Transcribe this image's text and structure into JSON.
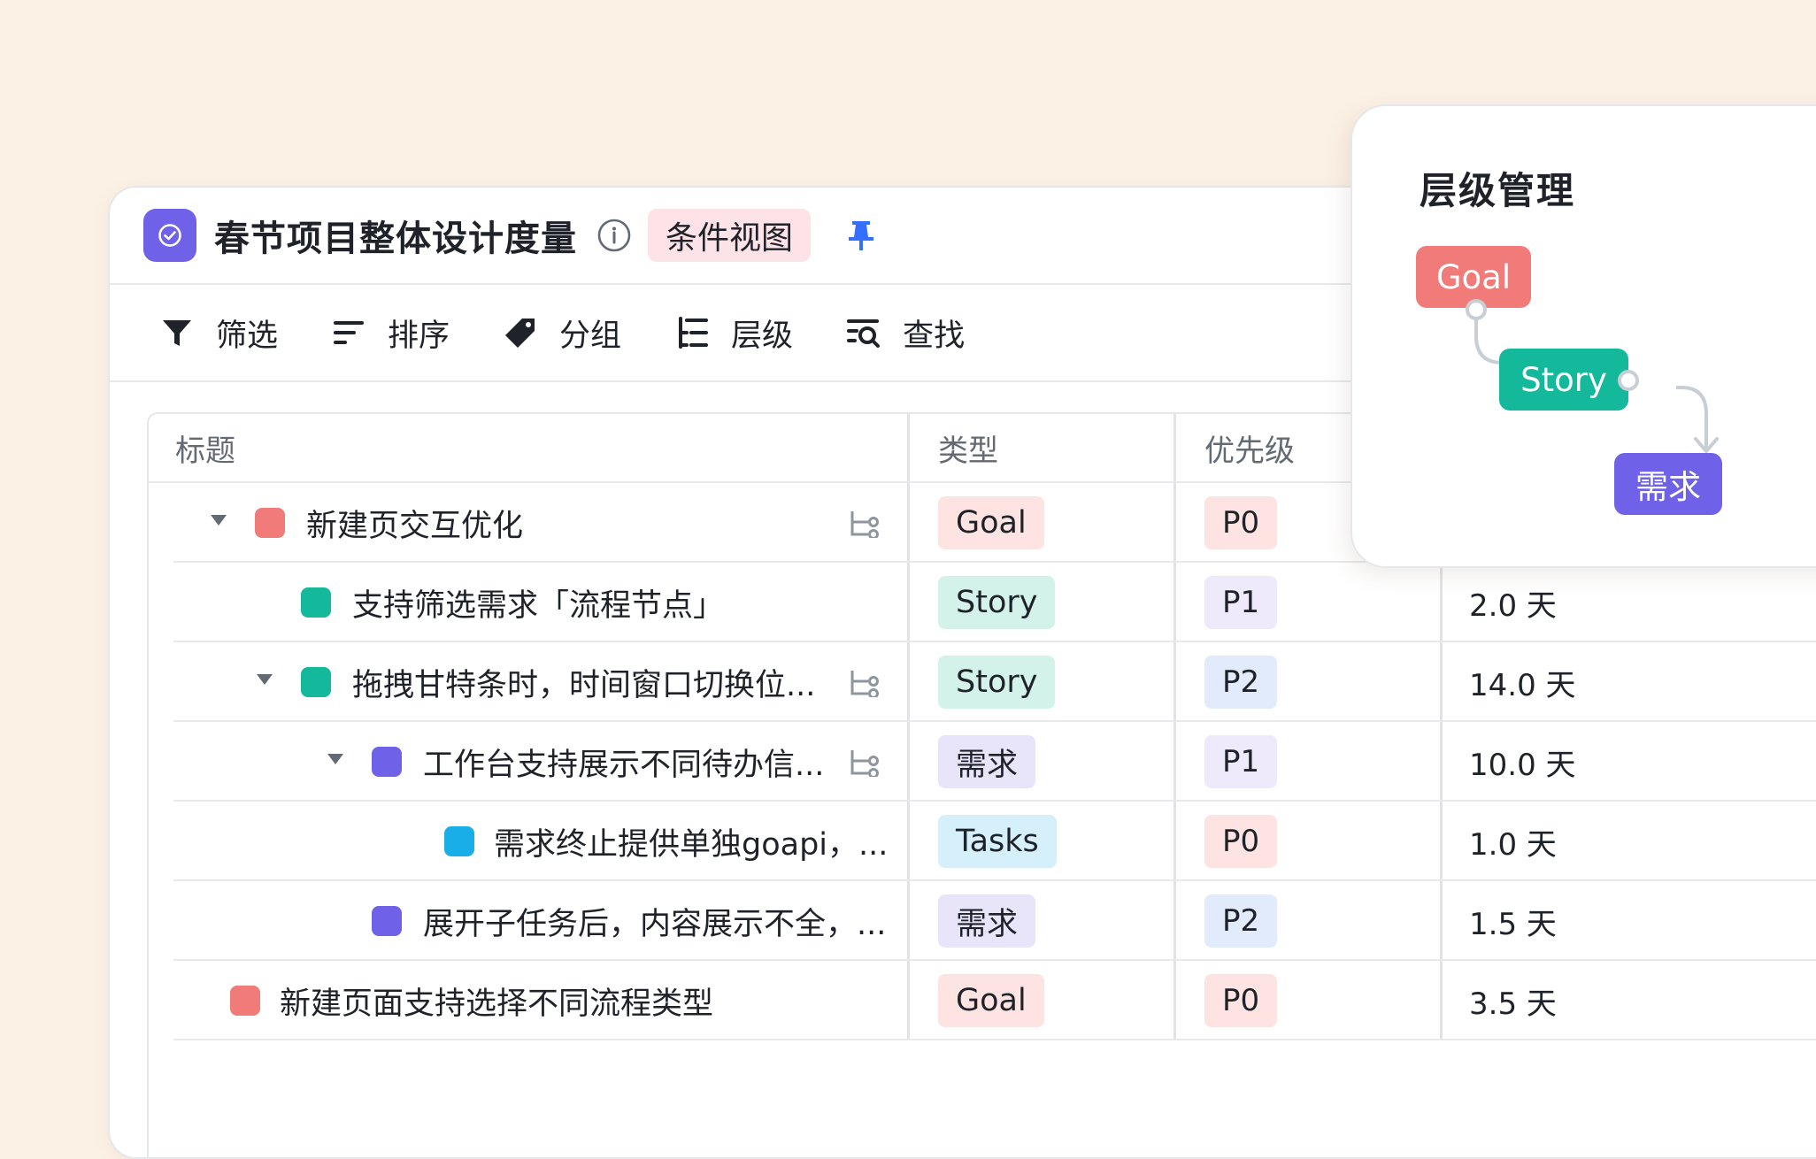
{
  "header": {
    "title": "春节项目整体设计度量",
    "view_badge": "条件视图"
  },
  "toolbar": {
    "filter": "筛选",
    "sort": "排序",
    "group": "分组",
    "hierarchy": "层级",
    "find": "查找"
  },
  "table": {
    "columns": [
      "标题",
      "类型",
      "优先级"
    ],
    "rows": [
      {
        "title": "新建页交互优化",
        "type": "Goal",
        "priority": "P0",
        "estimate": ""
      },
      {
        "title": "支持筛选需求「流程节点」",
        "type": "Story",
        "priority": "P1",
        "estimate": "2.0 天"
      },
      {
        "title": "拖拽甘特条时，时间窗口切换位...",
        "type": "Story",
        "priority": "P2",
        "estimate": "14.0 天"
      },
      {
        "title": "工作台支持展示不同待办信...",
        "type": "需求",
        "priority": "P1",
        "estimate": "10.0 天"
      },
      {
        "title": "需求终止提供单独goapi，...",
        "type": "Tasks",
        "priority": "P0",
        "estimate": "1.0 天"
      },
      {
        "title": "展开子任务后，内容展示不全，...",
        "type": "需求",
        "priority": "P2",
        "estimate": "1.5 天"
      },
      {
        "title": "新建页面支持选择不同流程类型",
        "type": "Goal",
        "priority": "P0",
        "estimate": "3.5 天"
      }
    ]
  },
  "hierarchy_popover": {
    "title": "层级管理",
    "nodes": [
      "Goal",
      "Story",
      "需求"
    ]
  },
  "colors": {
    "background": "#fcf1e5",
    "goal": "#f07b78",
    "story": "#14b89a",
    "requirement": "#7062e8",
    "tasks": "#1aaee8",
    "tag_goal_bg": "#fde3e1",
    "tag_story_bg": "#d3f3ea",
    "tag_req_bg": "#e8e5fb",
    "tag_tasks_bg": "#d5f0fb"
  }
}
